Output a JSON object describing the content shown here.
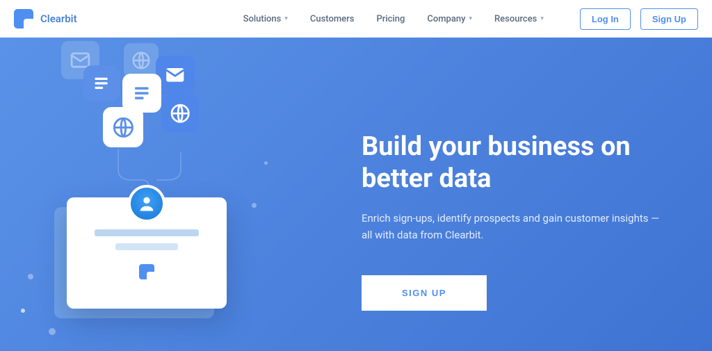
{
  "brand": "Clearbit",
  "nav": {
    "solutions": "Solutions",
    "customers": "Customers",
    "pricing": "Pricing",
    "company": "Company",
    "resources": "Resources",
    "login": "Log In",
    "signup": "Sign Up"
  },
  "hero": {
    "title": "Build your business on better data",
    "subtitle": "Enrich sign-ups, identify prospects and gain customer insights — all with data from Clearbit.",
    "cta": "SIGN UP"
  }
}
